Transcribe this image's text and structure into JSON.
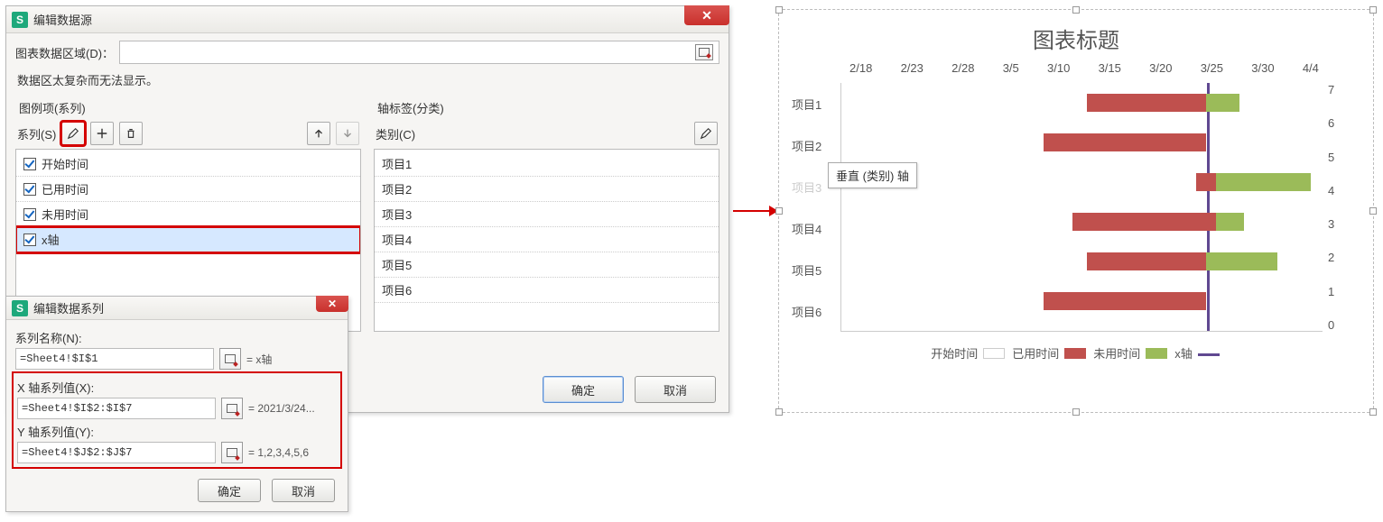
{
  "dlg1": {
    "title": "编辑数据源",
    "range_label": "图表数据区域(D)：",
    "range_value": "",
    "warning": "数据区太复杂而无法显示。",
    "legend_head": "图例项(系列)",
    "axis_head": "轴标签(分类)",
    "series_label": "系列(S)",
    "category_label": "类别(C)",
    "series_items": [
      {
        "label": "开始时间",
        "checked": true,
        "selected": false
      },
      {
        "label": "已用时间",
        "checked": true,
        "selected": false
      },
      {
        "label": "未用时间",
        "checked": true,
        "selected": false
      },
      {
        "label": "x轴",
        "checked": true,
        "selected": true
      }
    ],
    "category_items": [
      "项目1",
      "项目2",
      "项目3",
      "项目4",
      "项目5",
      "项目6"
    ],
    "ok": "确定",
    "cancel": "取消"
  },
  "dlg2": {
    "title": "编辑数据系列",
    "name_label": "系列名称(N):",
    "name_value": "=Sheet4!$I$1",
    "name_preview": "= x轴",
    "x_label": "X 轴系列值(X):",
    "x_value": "=Sheet4!$I$2:$I$7",
    "x_preview": "= 2021/3/24...",
    "y_label": "Y 轴系列值(Y):",
    "y_value": "=Sheet4!$J$2:$J$7",
    "y_preview": "= 1,2,3,4,5,6",
    "ok": "确定",
    "cancel": "取消"
  },
  "chart": {
    "title": "图表标题",
    "x_ticks": [
      "2/18",
      "2/23",
      "2/28",
      "3/5",
      "3/10",
      "3/15",
      "3/20",
      "3/25",
      "3/30",
      "4/4"
    ],
    "y2_ticks": [
      "7",
      "6",
      "5",
      "4",
      "3",
      "2",
      "1",
      "0"
    ],
    "categories": [
      "项目1",
      "项目2",
      "项目3",
      "项目4",
      "项目5",
      "项目6"
    ],
    "tooltip": "垂直 (类别) 轴",
    "legend": {
      "s1": "开始时间",
      "s2": "已用时间",
      "s3": "未用时间",
      "s4": "x轴"
    }
  },
  "chart_data": {
    "type": "bar",
    "orientation": "horizontal",
    "x_axis": {
      "type": "date",
      "min": "2021-02-18",
      "max": "2021-04-04",
      "ticks": [
        "2/18",
        "2/23",
        "2/28",
        "3/5",
        "3/10",
        "3/15",
        "3/20",
        "3/25",
        "3/30",
        "4/4"
      ]
    },
    "secondary_y_axis": {
      "min": 0,
      "max": 7,
      "ticks": [
        0,
        1,
        2,
        3,
        4,
        5,
        6,
        7
      ]
    },
    "categories": [
      "项目1",
      "项目2",
      "项目3",
      "项目4",
      "项目5",
      "项目6"
    ],
    "series": [
      {
        "name": "开始时间",
        "role": "offset-invisible",
        "color": "transparent",
        "values_date": [
          "2021-03-13",
          "2021-03-09",
          "2021-03-23",
          "2021-03-12",
          "2021-03-13",
          "2021-03-09"
        ]
      },
      {
        "name": "已用时间",
        "color": "#c0504d",
        "values_days": [
          11,
          15,
          3,
          14,
          11,
          15
        ]
      },
      {
        "name": "未用时间",
        "color": "#9bbb59",
        "values_days": [
          3,
          0,
          10,
          3,
          7,
          0
        ]
      },
      {
        "name": "x轴",
        "type": "line-vertical",
        "color": "#604891",
        "x_value_date": "2021-03-24",
        "y_values": [
          1,
          2,
          3,
          4,
          5,
          6
        ]
      }
    ],
    "title": "图表标题",
    "legend_position": "bottom"
  }
}
